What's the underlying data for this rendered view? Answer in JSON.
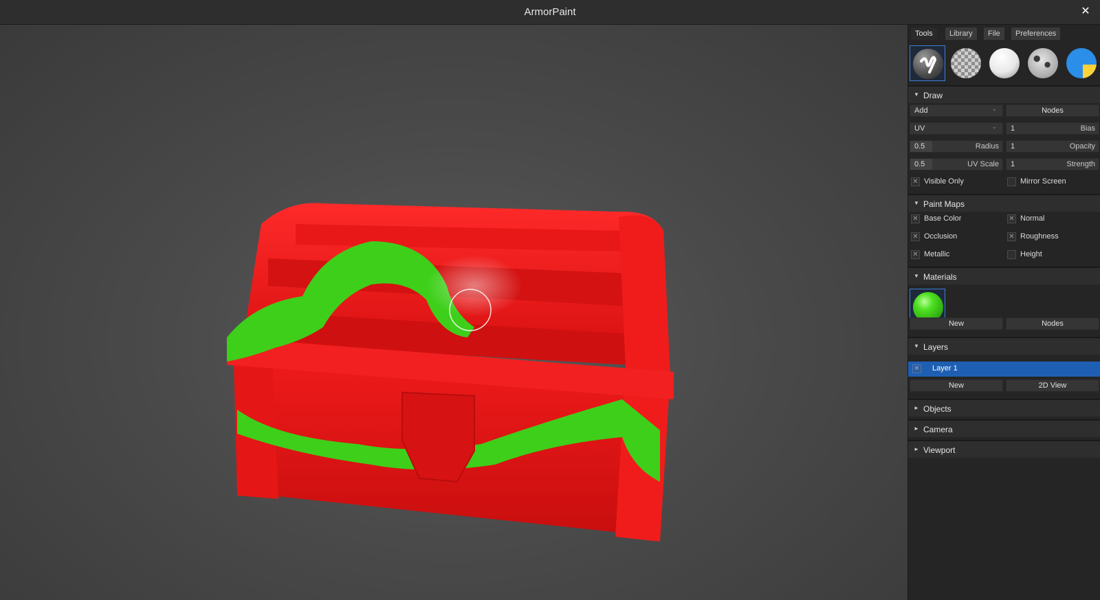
{
  "app": {
    "title": "ArmorPaint",
    "close_glyph": "✕"
  },
  "tabs": [
    "Tools",
    "Library",
    "File",
    "Preferences"
  ],
  "tools": [
    {
      "name": "brush-tool",
      "icon": "brush-stroke-icon"
    },
    {
      "name": "eraser-tool",
      "icon": "checker-sphere-icon"
    },
    {
      "name": "fill-tool",
      "icon": "fill-sphere-icon"
    },
    {
      "name": "decal-tool",
      "icon": "decal-sphere-icon"
    },
    {
      "name": "text-tool",
      "icon": "text-sphere-icon"
    }
  ],
  "draw": {
    "header": "Draw",
    "blending": "Add",
    "nodes_label": "Nodes",
    "mapping": "UV",
    "bias_value": "1",
    "bias_label": "Bias",
    "radius_value": "0.5",
    "radius_label": "Radius",
    "opacity_value": "1",
    "opacity_label": "Opacity",
    "uvscale_value": "0.5",
    "uvscale_label": "UV Scale",
    "strength_value": "1",
    "strength_label": "Strength",
    "visible_only_label": "Visible Only",
    "visible_only": true,
    "mirror_screen_label": "Mirror Screen",
    "mirror_screen": false
  },
  "paint_maps": {
    "header": "Paint Maps",
    "base_color": "Base Color",
    "normal": "Normal",
    "occlusion": "Occlusion",
    "roughness": "Roughness",
    "metallic": "Metallic",
    "height": "Height",
    "checked": {
      "base_color": true,
      "normal": true,
      "occlusion": true,
      "roughness": true,
      "metallic": true,
      "height": false
    }
  },
  "materials": {
    "header": "Materials",
    "new_label": "New",
    "nodes_label": "Nodes",
    "selected_color": "#3ecf1a"
  },
  "layers": {
    "header": "Layers",
    "items": [
      "Layer 1"
    ],
    "new_label": "New",
    "view2d_label": "2D View"
  },
  "collapsed": {
    "objects": "Objects",
    "camera": "Camera",
    "viewport": "Viewport"
  },
  "colors": {
    "accent": "#1f5fb3",
    "paint_red": "#e01515",
    "paint_green": "#3ecf1a"
  }
}
